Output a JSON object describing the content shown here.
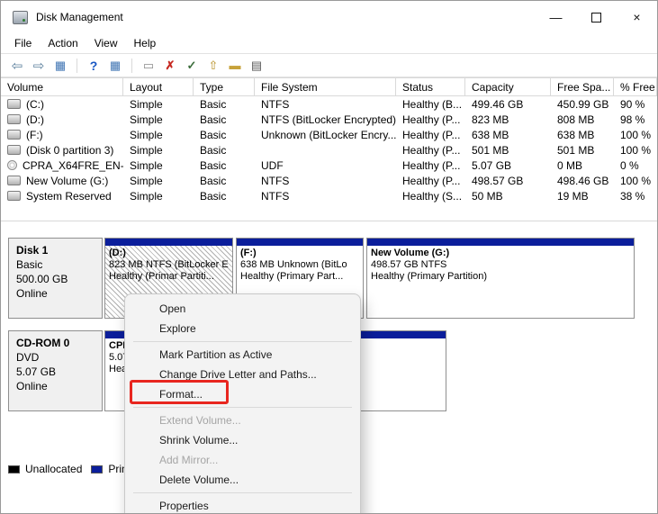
{
  "titlebar": {
    "title": "Disk Management",
    "controls": [
      {
        "name": "minimize-icon",
        "glyph": "—"
      },
      {
        "name": "maximize-icon",
        "glyph": ""
      },
      {
        "name": "close-icon",
        "glyph": "×"
      }
    ]
  },
  "menubar": {
    "items": [
      {
        "label": "File"
      },
      {
        "label": "Action"
      },
      {
        "label": "View"
      },
      {
        "label": "Help"
      }
    ]
  },
  "toolbar": {
    "icons": [
      {
        "name": "back-icon",
        "glyph": "⇦"
      },
      {
        "name": "forward-icon",
        "glyph": "⇨"
      },
      {
        "name": "console-tree-icon",
        "glyph": "▦"
      },
      {
        "name": "help-icon",
        "glyph": "?"
      },
      {
        "name": "action-pane-icon",
        "glyph": "▦"
      },
      {
        "name": "tooltip-icon",
        "glyph": "▭"
      },
      {
        "name": "delete-icon",
        "glyph": "✗"
      },
      {
        "name": "check-icon",
        "glyph": "✓"
      },
      {
        "name": "open-folder-icon",
        "glyph": "⇧"
      },
      {
        "name": "drive-icon",
        "glyph": "▬"
      },
      {
        "name": "list-view-icon",
        "glyph": "▤"
      }
    ]
  },
  "volume_table": {
    "columns": [
      "Volume",
      "Layout",
      "Type",
      "File System",
      "Status",
      "Capacity",
      "Free Spa...",
      "% Free"
    ],
    "rows": [
      {
        "volume": "(C:)",
        "layout": "Simple",
        "type": "Basic",
        "file_system": "NTFS",
        "status": "Healthy (B...",
        "capacity": "499.46 GB",
        "free_space": "450.99 GB",
        "pct_free": "90 %"
      },
      {
        "volume": "(D:)",
        "layout": "Simple",
        "type": "Basic",
        "file_system": "NTFS (BitLocker Encrypted)",
        "status": "Healthy (P...",
        "capacity": "823 MB",
        "free_space": "808 MB",
        "pct_free": "98 %"
      },
      {
        "volume": "(F:)",
        "layout": "Simple",
        "type": "Basic",
        "file_system": "Unknown (BitLocker Encry...",
        "status": "Healthy (P...",
        "capacity": "638 MB",
        "free_space": "638 MB",
        "pct_free": "100 %"
      },
      {
        "volume": "(Disk 0 partition 3)",
        "layout": "Simple",
        "type": "Basic",
        "file_system": "",
        "status": "Healthy (P...",
        "capacity": "501 MB",
        "free_space": "501 MB",
        "pct_free": "100 %"
      },
      {
        "volume": "CPRA_X64FRE_EN-...",
        "layout": "Simple",
        "type": "Basic",
        "file_system": "UDF",
        "status": "Healthy (P...",
        "capacity": "5.07 GB",
        "free_space": "0 MB",
        "pct_free": "0 %"
      },
      {
        "volume": "New Volume (G:)",
        "layout": "Simple",
        "type": "Basic",
        "file_system": "NTFS",
        "status": "Healthy (P...",
        "capacity": "498.57 GB",
        "free_space": "498.46 GB",
        "pct_free": "100 %"
      },
      {
        "volume": "System Reserved",
        "layout": "Simple",
        "type": "Basic",
        "file_system": "NTFS",
        "status": "Healthy (S...",
        "capacity": "50 MB",
        "free_space": "19 MB",
        "pct_free": "38 %"
      }
    ]
  },
  "disks": [
    {
      "name": "Disk 1",
      "kind": "Basic",
      "size": "500.00 GB",
      "status": "Online",
      "partitions": [
        {
          "title": "(D:)",
          "line2": "823 MB NTFS (BitLocker E",
          "line3": "Healthy (Primar Partiti..."
        },
        {
          "title": "(F:)",
          "line2": "638 MB Unknown (BitLo",
          "line3": "Healthy (Primary Part..."
        },
        {
          "title": "New Volume  (G:)",
          "line2": "498.57 GB NTFS",
          "line3": "Healthy (Primary Partition)"
        }
      ]
    },
    {
      "name": "CD-ROM 0",
      "kind": "DVD",
      "size": "5.07 GB",
      "status": "Online",
      "partitions": [
        {
          "title": "CPRA_X64FRE_EN-...",
          "line2": "5.07 GB UDF",
          "line3": "Healthy (Primary Partition)"
        }
      ]
    }
  ],
  "legend": {
    "items": [
      {
        "label": "Unallocated",
        "color": "#000000"
      },
      {
        "label": "Primary partition",
        "color": "#0b1e9b"
      }
    ]
  },
  "context_menu": {
    "items": [
      {
        "label": "Open",
        "enabled": true
      },
      {
        "label": "Explore",
        "enabled": true
      },
      {
        "type": "separator"
      },
      {
        "label": "Mark Partition as Active",
        "enabled": true
      },
      {
        "label": "Change Drive Letter and Paths...",
        "enabled": true
      },
      {
        "label": "Format...",
        "enabled": true,
        "highlighted": true
      },
      {
        "type": "separator"
      },
      {
        "label": "Extend Volume...",
        "enabled": false
      },
      {
        "label": "Shrink Volume...",
        "enabled": true
      },
      {
        "label": "Add Mirror...",
        "enabled": false
      },
      {
        "label": "Delete Volume...",
        "enabled": true
      },
      {
        "type": "separator"
      },
      {
        "label": "Properties",
        "enabled": true
      }
    ]
  },
  "colors": {
    "partition_header": "#0b1e9b",
    "selected_hatch": "#b0b0b0",
    "highlight_box": "#e8261f",
    "unallocated": "#000000",
    "primary_partition": "#0b1e9b"
  }
}
